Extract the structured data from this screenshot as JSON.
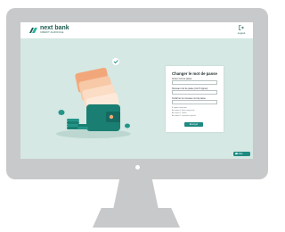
{
  "brand": {
    "name": "next bank",
    "subtitle": "CRÉDIT AGRICOLE"
  },
  "header": {
    "logout_label": "Logout",
    "logout_icon": "logout-icon"
  },
  "form": {
    "title": "Changer le mot de passe",
    "fields": [
      {
        "label": "Ancien mot de passe",
        "value": ""
      },
      {
        "label": "Nouveau mot de passe (min 8 signes)",
        "value": ""
      },
      {
        "label": "Confirmer le nouveau mot de passe",
        "value": ""
      }
    ],
    "requirements": [
      "8 signes minimum",
      "Au moins 1 lettre majuscule",
      "Au moins 1 chiffre",
      "Au moins 1 caractère spécial"
    ],
    "submit_label": "Envoyer"
  },
  "help": {
    "label": "Aide",
    "icon": "chat-icon"
  },
  "colors": {
    "accent": "#1e8a82",
    "brand": "#1d5a4f",
    "screen_bg": "#d5e8e3",
    "monitor": "#c8c9cb"
  }
}
